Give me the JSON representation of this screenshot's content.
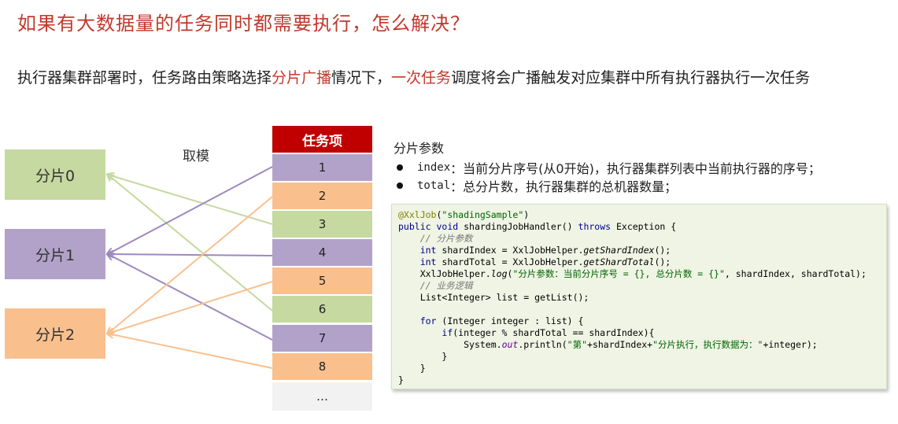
{
  "title": "如果有大数据量的任务同时都需要执行，怎么解决？",
  "description": {
    "p1": "执行器集群部署时，任务路由策略选择",
    "h1": "分片广播",
    "p2": "情况下，",
    "h2": "一次任务",
    "p3": "调度将会广播触发对应集群中所有执行器执行一次任务"
  },
  "shards": [
    "分片0",
    "分片1",
    "分片2"
  ],
  "mod_label": "取模",
  "task_header": "任务项",
  "tasks": [
    "1",
    "2",
    "3",
    "4",
    "5",
    "6",
    "7",
    "8",
    "…"
  ],
  "params": {
    "title": "分片参数",
    "items": [
      {
        "key": "index",
        "text": "：当前分片序号(从0开始)，执行器集群列表中当前执行器的序号；"
      },
      {
        "key": "total",
        "text": "：总分片数，执行器集群的总机器数量；"
      }
    ]
  },
  "code": {
    "annotation": "@XxlJob",
    "annotation_arg": "\"shadingSample\"",
    "sig_public": "public",
    "sig_void": "void",
    "sig_name": " shardingJobHandler() ",
    "sig_throws": "throws",
    "sig_rest": " Exception {",
    "comment1": "// 分片参数",
    "kw_int": "int",
    "line_idx_a": " shardIndex = XxlJobHelper.",
    "line_idx_m": "getShardIndex",
    "line_idx_b": "();",
    "line_tot_a": " shardTotal = XxlJobHelper.",
    "line_tot_m": "getShardTotal",
    "line_tot_b": "();",
    "line_log_a": "XxlJobHelper.",
    "line_log_m": "log",
    "line_log_b": "(",
    "line_log_str": "\"分片参数：当前分片序号 = {}, 总分片数 = {}\"",
    "line_log_c": ", shardIndex, shardTotal);",
    "comment2": "// 业务逻辑",
    "line_list": "List<Integer> list = getList();",
    "kw_for": "for",
    "line_for": " (Integer integer : list) {",
    "kw_if": "if",
    "line_if": "(integer % shardTotal == shardIndex){",
    "line_print_a": "System.",
    "line_print_out": "out",
    "line_print_b": ".println(",
    "line_print_s1": "\"第\"",
    "line_print_c": "+shardIndex+",
    "line_print_s2": "\"分片执行，执行数据为：\"",
    "line_print_d": "+integer);",
    "close": "}"
  },
  "colors": {
    "title_red": "#c0392b",
    "header_red": "#c00000",
    "green": "#c5d9a0",
    "purple": "#b2a2c9",
    "orange": "#f9c08e",
    "line_green": "#c5d9a0",
    "line_purple": "#9c89bf",
    "line_orange": "#f9c08e"
  }
}
